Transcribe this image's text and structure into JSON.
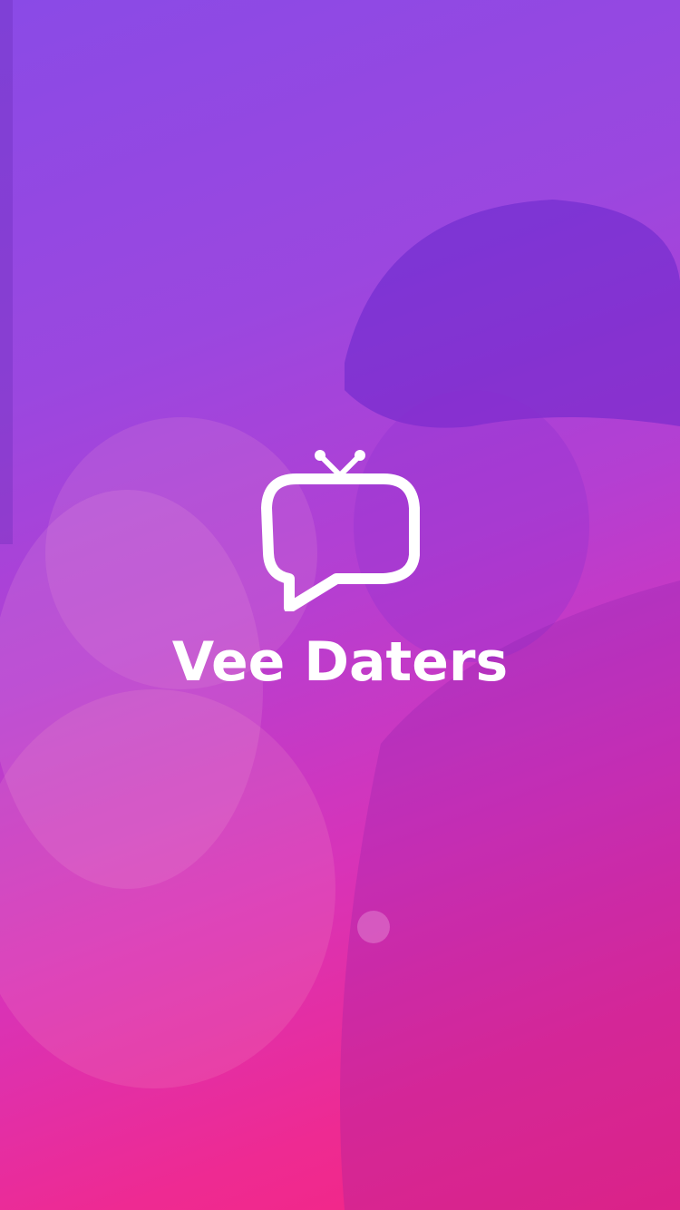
{
  "app": {
    "title": "Vee Daters"
  },
  "splash": {
    "logo_icon": "tv-chat-bubble-icon",
    "background_image": "couple-kissing-photo",
    "gradient_colors": [
      "#8a4ae6",
      "#b43fd2",
      "#f6257f"
    ],
    "text_color": "#ffffff"
  }
}
